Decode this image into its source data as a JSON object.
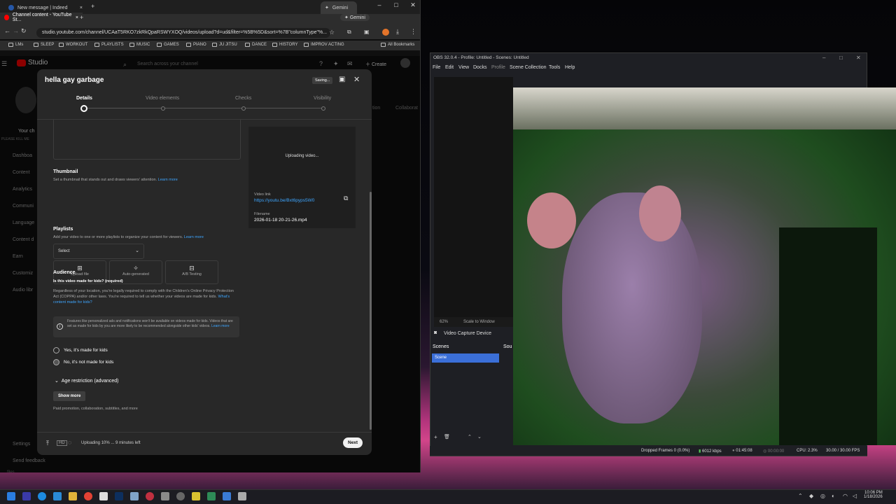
{
  "browser": {
    "tabs": [
      {
        "label": "New message | Indeed",
        "active": false
      },
      {
        "label": "Channel content - YouTube St...",
        "active": true
      }
    ],
    "gemini_tab": "Gemini",
    "gemini_button": "Gemini",
    "url": "studio.youtube.com/channel/UCAaT5RKO7zkRkQpaRSWYXOQ/videos/upload?d=ud&filter=%5B%5D&sort=%7B\"columnType\"%...",
    "bookmarks": [
      "LMs",
      "SLEEP",
      "WORKOUT",
      "PLAYLISTS",
      "MUSIC",
      "GAMES",
      "PIANO",
      "JU JITSU",
      "DANCE",
      "HISTORY",
      "IMPROV ACTING"
    ],
    "all_bookmarks": "All Bookmarks"
  },
  "studio": {
    "logo": "Studio",
    "search_placeholder": "Search across your channel",
    "create": "Create",
    "your_channel": "Your ch",
    "channel_name": "PLEASE KILL ME",
    "sidebar": [
      "Dashboa",
      "Content",
      "Analytics",
      "Communi",
      "Language",
      "Content d",
      "Earn",
      "Customiz",
      "Audio libr"
    ],
    "settings": "Settings",
    "send_feedback": "Send feedback",
    "right_tabs": [
      "tion",
      "Collaborat"
    ],
    "bottom_hint": "files"
  },
  "modal": {
    "title": "hella gay garbage",
    "saving": "Saving...",
    "steps": [
      "Details",
      "Video elements",
      "Checks",
      "Visibility"
    ],
    "uploading_video": "Uploading video...",
    "video_link_label": "Video link",
    "video_link": "https://youtu.be/Bxt6pyps5W0",
    "filename_label": "Filename",
    "filename": "2026-01-18 20-21-26.mp4",
    "thumbnail": {
      "heading": "Thumbnail",
      "desc": "Set a thumbnail that stands out and draws viewers' attention.",
      "learn_more": "Learn more",
      "options": [
        "Upload file",
        "Auto-generated",
        "A/B Testing"
      ]
    },
    "playlists": {
      "heading": "Playlists",
      "desc": "Add your video to one or more playlists to organize your content for viewers.",
      "learn_more": "Learn more",
      "select": "Select"
    },
    "audience": {
      "heading": "Audience",
      "question": "Is this video made for kids? (required)",
      "desc": "Regardless of your location, you're legally required to comply with the Children's Online Privacy Protection Act (COPPA) and/or other laws. You're required to tell us whether your videos are made for kids.",
      "link": "What's content made for kids?",
      "notice": "Features like personalized ads and notifications won't be available on videos made for kids. Videos that are set as made for kids by you are more likely to be recommended alongside other kids' videos.",
      "notice_link": "Learn more",
      "opt_yes": "Yes, it's made for kids",
      "opt_no": "No, it's not made for kids"
    },
    "age_restriction": "Age restriction (advanced)",
    "show_more": "Show more",
    "show_more_desc": "Paid promotion, collaboration, subtitles, and more",
    "upload_status": "Uploading 10% ... 9 minutes left",
    "next": "Next"
  },
  "obs": {
    "title": "OBS 32.0.4 - Profile: Untitled - Scenes: Untitled",
    "menu": [
      "File",
      "Edit",
      "View",
      "Docks",
      "Profile",
      "Scene Collection",
      "Tools",
      "Help"
    ],
    "zoom": "62%",
    "scale": "Scale to Window",
    "source_name": "Video Capture Device",
    "scenes_label": "Scenes",
    "scene_item": "Scene",
    "sources_label": "Sou",
    "status": {
      "dropped": "Dropped Frames 0 (0.0%)",
      "bitrate": "6012 kbps",
      "rec_time": "01:45:08",
      "stream_time": "00:00:00",
      "cpu": "CPU: 2.3%",
      "fps": "30.00 / 30.00 FPS"
    }
  },
  "taskbar": {
    "time": "10:06 PM",
    "date": "1/18/2026"
  }
}
